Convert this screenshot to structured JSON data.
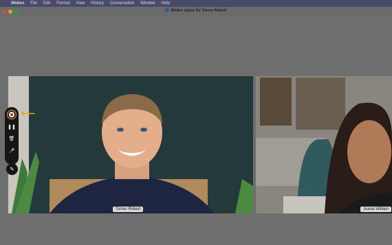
{
  "menubar": {
    "apple_icon": "apple-icon",
    "items": [
      "Webex",
      "File",
      "Edit",
      "Format",
      "View",
      "History",
      "Conversation",
      "Window",
      "Help"
    ]
  },
  "window": {
    "title": "Webex space for Torres Robert",
    "traffic_colors": [
      "#e0443e",
      "#dea123",
      "#1aab29"
    ]
  },
  "participants": [
    {
      "name": "Torres Robert"
    },
    {
      "name": "Joana William"
    }
  ],
  "toolbar": {
    "record_icon": "record-icon",
    "pause_icon": "pause-icon",
    "delete_icon": "trash-icon",
    "mic_icon": "microphone-icon",
    "annotate_icon": "pencil-icon",
    "accent": "#e8a81c"
  }
}
